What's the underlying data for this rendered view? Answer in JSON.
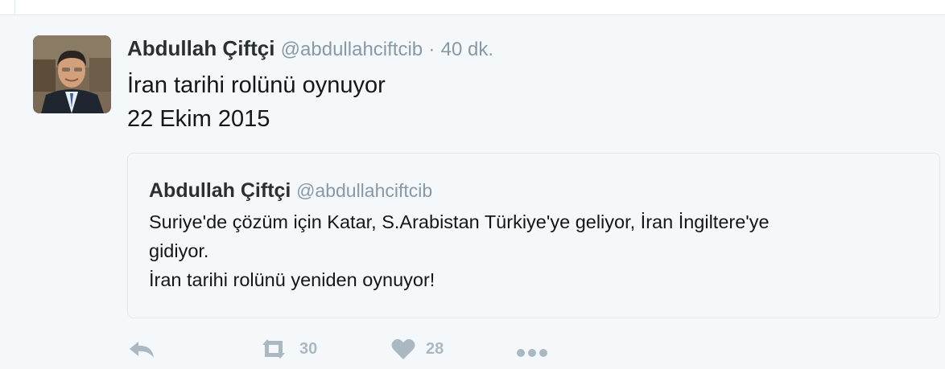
{
  "tweet": {
    "fullname": "Abdullah Çiftçi",
    "username": "@abdullahciftcib",
    "separator": "·",
    "timestamp": "40 dk.",
    "text_line1": "İran tarihi rolünü oynuyor",
    "text_line2": "22 Ekim 2015"
  },
  "quoted_tweet": {
    "fullname": "Abdullah Çiftçi",
    "username": "@abdullahciftcib",
    "text_line1": "Suriye'de çözüm için Katar, S.Arabistan Türkiye'ye geliyor, İran İngiltere'ye",
    "text_line2": "gidiyor.",
    "text_line3": "İran tarihi rolünü yeniden oynuyor!"
  },
  "actions": {
    "reply_icon": "reply-icon",
    "retweet_icon": "retweet-icon",
    "retweet_count": "30",
    "like_icon": "heart-icon",
    "like_count": "28",
    "more_icon": "more-icon"
  },
  "colors": {
    "background": "#f5f8fa",
    "text": "#14171a",
    "muted": "#8899a6",
    "action": "#aab8c2",
    "border": "#e1e8ed"
  }
}
